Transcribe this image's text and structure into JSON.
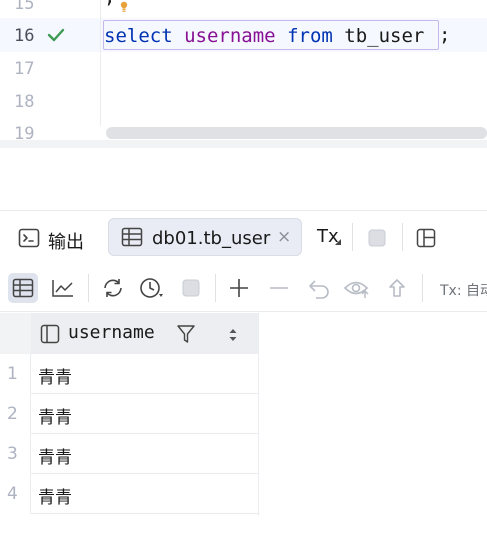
{
  "editor": {
    "line_numbers": [
      "15",
      "16",
      "17",
      "18",
      "19"
    ],
    "active_line": "16",
    "prev_line_text": ";",
    "code": {
      "kw_select": "select",
      "column": "username",
      "kw_from": "from",
      "table": "tb_user",
      "terminator": ";"
    }
  },
  "tabs": {
    "output_label": "输出",
    "active_tab_label": "db01.tb_user",
    "close_glyph": "×",
    "tx_label": "Tx"
  },
  "toolbar": {
    "tx_mode_label": "Tx: 自动",
    "icons": [
      "table-view-icon",
      "chart-view-icon",
      "refresh-icon",
      "history-icon",
      "stop-icon",
      "add-row-icon",
      "remove-row-icon",
      "revert-icon",
      "preview-icon",
      "submit-icon"
    ]
  },
  "grid": {
    "column_header": "username",
    "rows": [
      {
        "num": "1",
        "username": "青青"
      },
      {
        "num": "2",
        "username": "青青"
      },
      {
        "num": "3",
        "username": "青青"
      },
      {
        "num": "4",
        "username": "青青"
      }
    ]
  },
  "colors": {
    "keyword": "#0033b3",
    "identifier": "#871094",
    "check": "#3e9b56",
    "bulb": "#e8a23c"
  }
}
